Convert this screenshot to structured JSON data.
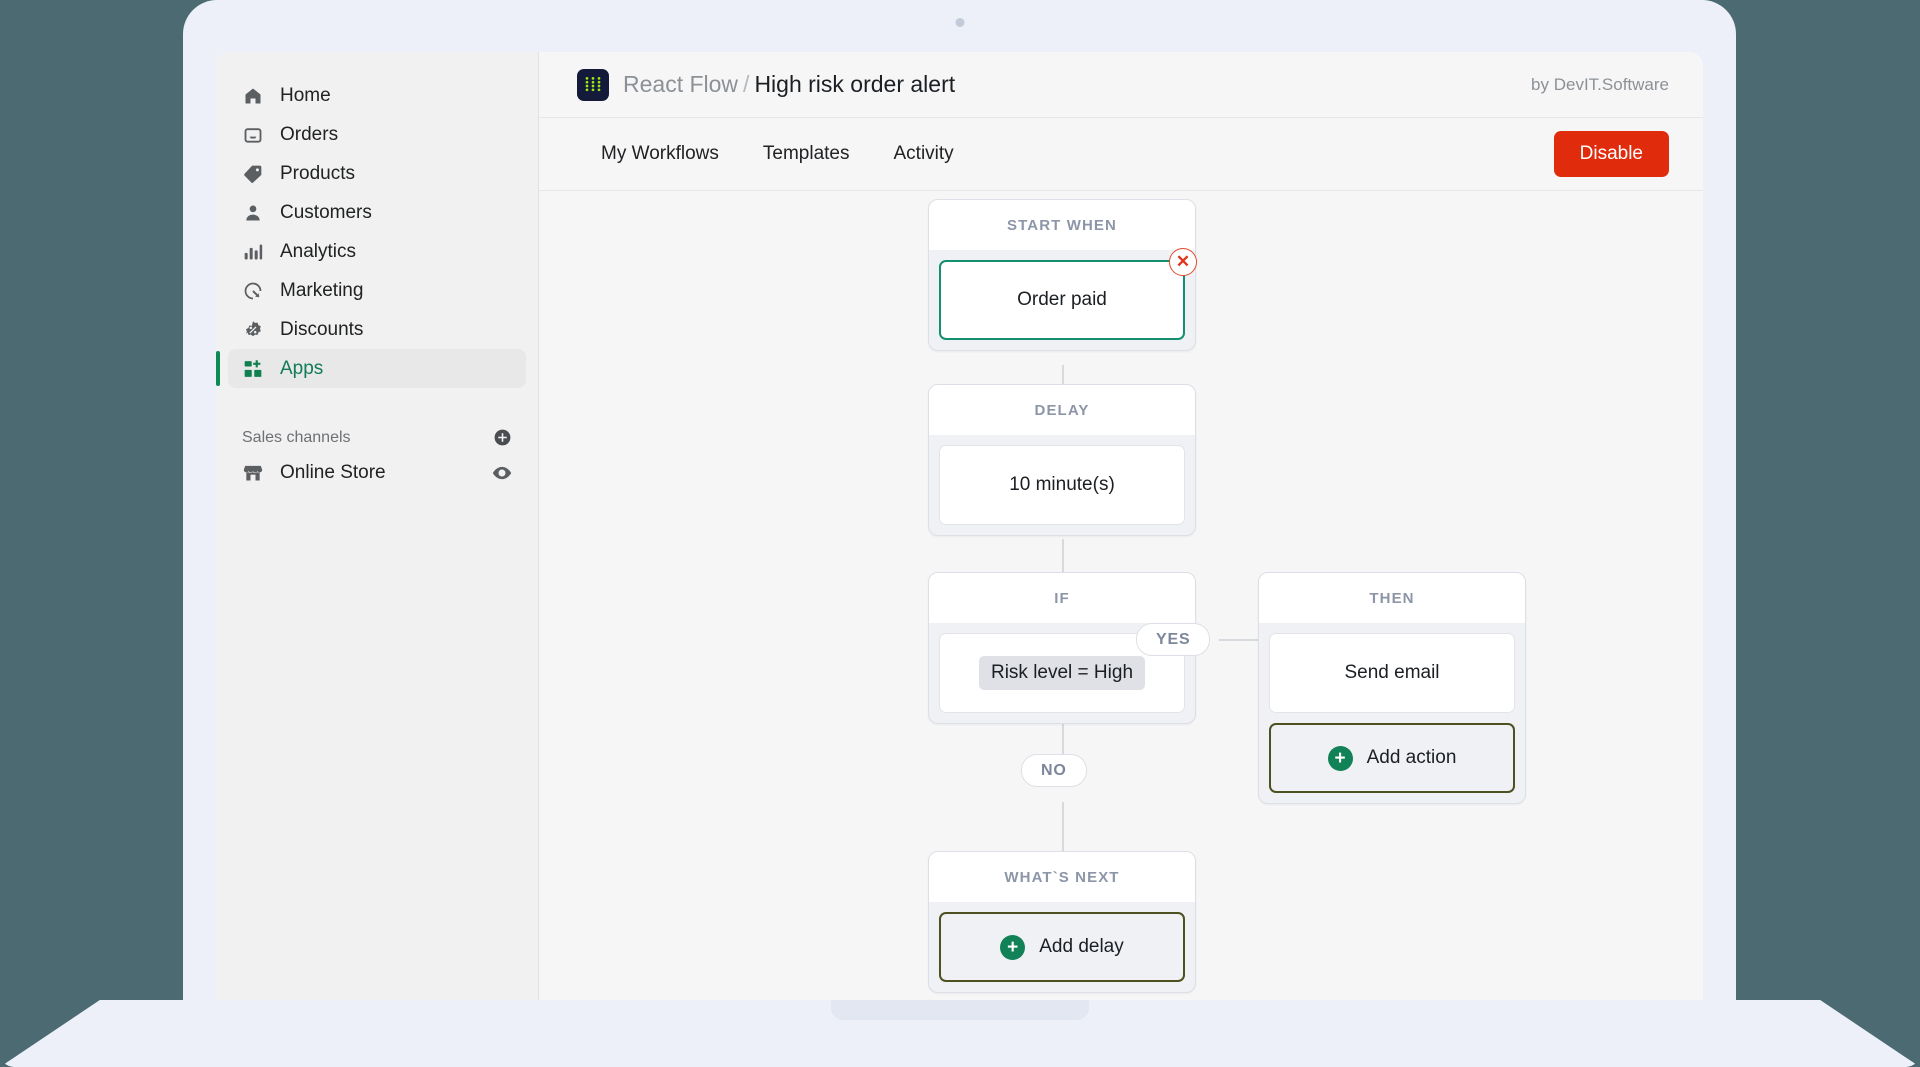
{
  "sidebar": {
    "items": [
      {
        "label": "Home",
        "icon": "home-icon",
        "active": false
      },
      {
        "label": "Orders",
        "icon": "orders-icon",
        "active": false
      },
      {
        "label": "Products",
        "icon": "tag-icon",
        "active": false
      },
      {
        "label": "Customers",
        "icon": "person-icon",
        "active": false
      },
      {
        "label": "Analytics",
        "icon": "bar-chart-icon",
        "active": false
      },
      {
        "label": "Marketing",
        "icon": "megaphone-icon",
        "active": false
      },
      {
        "label": "Discounts",
        "icon": "discount-icon",
        "active": false
      },
      {
        "label": "Apps",
        "icon": "apps-icon",
        "active": true
      }
    ],
    "section_title": "Sales channels",
    "add_channel_icon": "plus-circle-icon",
    "channels": [
      {
        "label": "Online Store",
        "icon": "storefront-icon",
        "trailing_icon": "eye-icon"
      }
    ]
  },
  "header": {
    "app_icon": "react-flow-app-icon",
    "app_name": "React Flow",
    "separator": "/",
    "workflow_name": "High risk order alert",
    "vendor": "by DevIT.Software"
  },
  "tabs": [
    {
      "label": "My Workflows"
    },
    {
      "label": "Templates"
    },
    {
      "label": "Activity"
    }
  ],
  "actions": {
    "disable_label": "Disable",
    "disable_color": "#E02B0C"
  },
  "flow": {
    "nodes": [
      {
        "id": "trigger",
        "title": "START WHEN",
        "card_label": "Order paid",
        "selected": true,
        "delete_icon": "close-circle-icon"
      },
      {
        "id": "delay",
        "title": "DELAY",
        "card_label": "10 minute(s)"
      },
      {
        "id": "condition",
        "title": "IF",
        "card_label": "Risk level = High"
      },
      {
        "id": "then",
        "title": "THEN",
        "card_label": "Send email",
        "add_label": "Add action",
        "add_icon": "plus-circle-icon"
      },
      {
        "id": "next",
        "title": "WHAT`S NEXT",
        "add_label": "Add delay",
        "add_icon": "plus-circle-icon"
      }
    ],
    "edge_labels": [
      {
        "id": "yes",
        "label": "YES"
      },
      {
        "id": "no",
        "label": "NO"
      }
    ]
  },
  "colors": {
    "background": "#4C6A72",
    "laptop": "#EDF0F9",
    "accent_green": "#0D8A54",
    "danger_red": "#E02B0C",
    "selected_teal": "#149070"
  }
}
